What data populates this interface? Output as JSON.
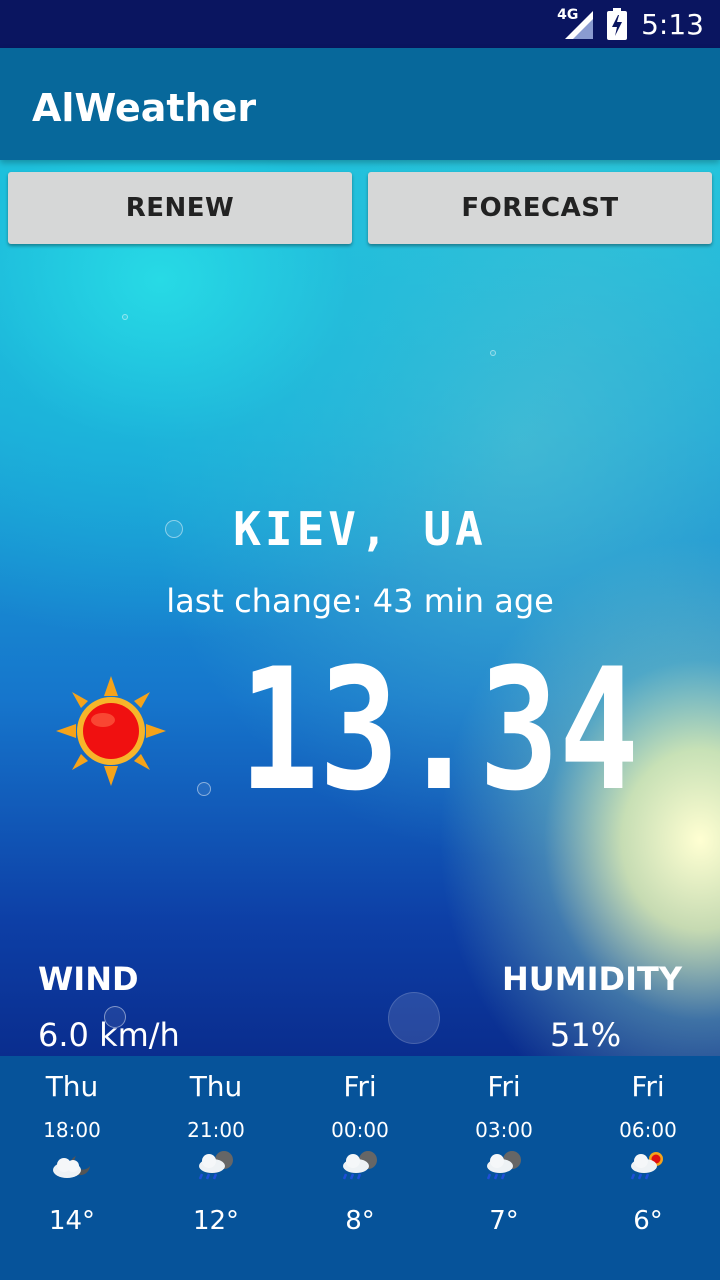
{
  "status_bar": {
    "network": "4G",
    "time": "5:13",
    "icons": [
      "signal-icon",
      "battery-charging-icon"
    ]
  },
  "app_bar": {
    "title": "AlWeather"
  },
  "buttons": {
    "renew": "RENEW",
    "forecast": "FORECAST"
  },
  "current": {
    "city": "KIEV, UA",
    "last_change": "last change: 43 min age",
    "temperature": "13.34",
    "condition_icon": "sun-icon",
    "wind_label": "WIND",
    "wind_value": "6.0 km/h",
    "humidity_label": "HUMIDITY",
    "humidity_value": "51%"
  },
  "forecast": [
    {
      "day": "Thu",
      "time": "18:00",
      "icon": "cloud-moon-icon",
      "temp": "14°"
    },
    {
      "day": "Thu",
      "time": "21:00",
      "icon": "rain-cloud-icon",
      "temp": "12°"
    },
    {
      "day": "Fri",
      "time": "00:00",
      "icon": "rain-cloud-icon",
      "temp": "8°"
    },
    {
      "day": "Fri",
      "time": "03:00",
      "icon": "rain-cloud-icon",
      "temp": "7°"
    },
    {
      "day": "Fri",
      "time": "06:00",
      "icon": "rain-sun-icon",
      "temp": "6°"
    }
  ],
  "colors": {
    "status_bar": "#0a1560",
    "app_bar": "#07689b",
    "forecast_bar": "#06539a",
    "button": "#d6d7d7"
  }
}
